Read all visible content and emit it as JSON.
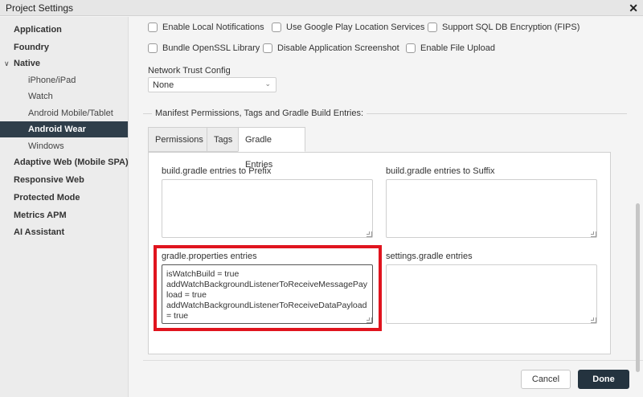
{
  "window": {
    "title": "Project Settings",
    "close_label": "✕"
  },
  "sidebar": {
    "items": [
      {
        "label": "Application"
      },
      {
        "label": "Foundry"
      },
      {
        "label": "Native",
        "chevron": "chevron-down-icon"
      },
      {
        "label": "iPhone/iPad"
      },
      {
        "label": "Watch"
      },
      {
        "label": "Android Mobile/Tablet"
      },
      {
        "label": "Android Wear",
        "selected": true
      },
      {
        "label": "Windows"
      },
      {
        "label": "Adaptive Web (Mobile SPA)"
      },
      {
        "label": "Responsive Web"
      },
      {
        "label": "Protected Mode"
      },
      {
        "label": "Metrics APM"
      },
      {
        "label": "AI Assistant"
      }
    ]
  },
  "options": {
    "row1": [
      {
        "label": "Enable Local Notifications",
        "checked": false
      },
      {
        "label": "Use Google Play Location Services",
        "checked": false
      },
      {
        "label": "Support SQL DB Encryption (FIPS)",
        "checked": false
      }
    ],
    "row2": [
      {
        "label": "Bundle OpenSSL Library",
        "checked": false
      },
      {
        "label": "Disable Application Screenshot",
        "checked": false
      },
      {
        "label": "Enable File Upload",
        "checked": false
      }
    ]
  },
  "network_trust": {
    "label": "Network Trust Config",
    "value": "None",
    "caret": "⌄"
  },
  "manifest_section": {
    "title": "Manifest Permissions, Tags and Gradle Build Entries:"
  },
  "tabs": [
    {
      "label": "Permissions"
    },
    {
      "label": "Tags"
    },
    {
      "label": "Gradle Entries",
      "active": true
    }
  ],
  "gradle": {
    "prefix_label": "build.gradle entries to Prefix",
    "prefix_value": "",
    "suffix_label": "build.gradle entries to Suffix",
    "suffix_value": "",
    "properties_label": "gradle.properties entries",
    "properties_value": "isWatchBuild = true\naddWatchBackgroundListenerToReceiveMessagePayload = true\naddWatchBackgroundListenerToReceiveDataPayload = true",
    "settings_label": "settings.gradle entries",
    "settings_value": ""
  },
  "footer": {
    "cancel_label": "Cancel",
    "done_label": "Done"
  },
  "colors": {
    "accent": "#2f3e4a",
    "highlight": "#e0141e",
    "done_button": "#24333f"
  }
}
